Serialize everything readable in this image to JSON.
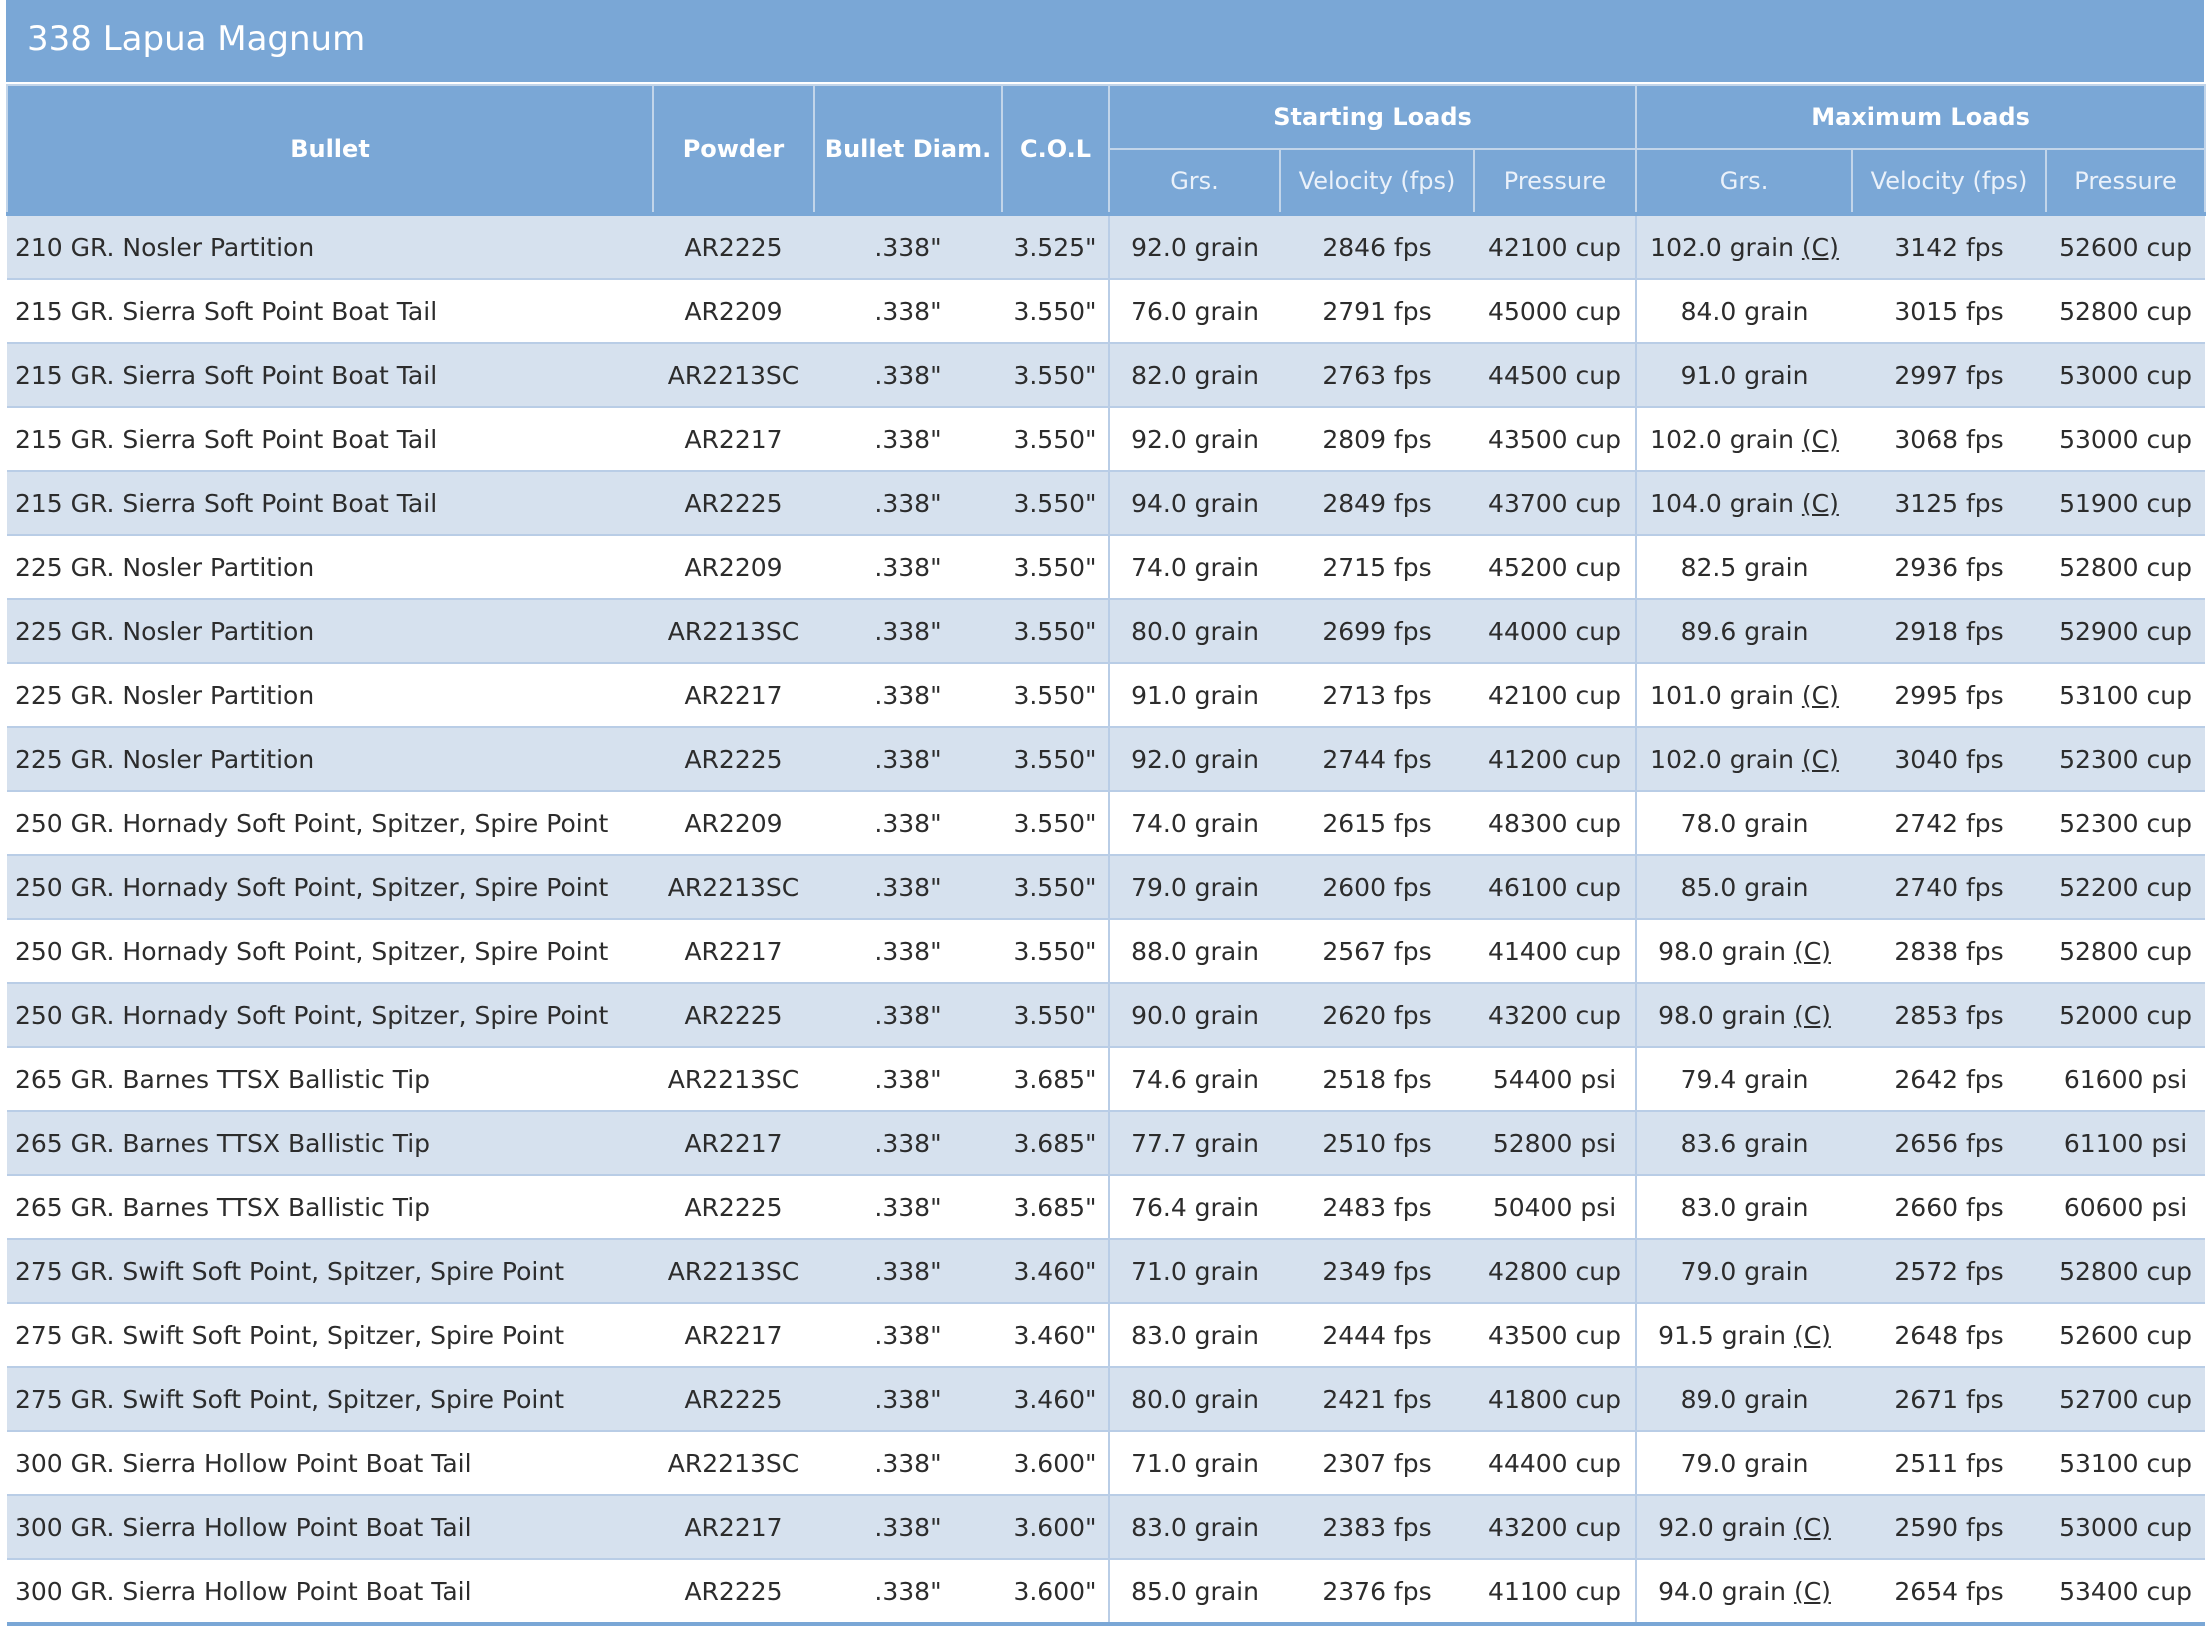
{
  "page": {
    "title": "338 Lapua Magnum"
  },
  "headers": {
    "bullet": "Bullet",
    "powder": "Powder",
    "bullet_diam": "Bullet Diam.",
    "col": "C.O.L",
    "starting_loads": "Starting Loads",
    "maximum_loads": "Maximum Loads",
    "grs": "Grs.",
    "velocity": "Velocity (fps)",
    "pressure": "Pressure"
  },
  "rows": [
    {
      "bullet": "210 GR. Nosler Partition",
      "powder": "AR2225",
      "diam": ".338\"",
      "col": "3.525\"",
      "s_grs": "92.0 grain",
      "s_vel": "2846 fps",
      "s_press": "42100 cup",
      "m_grs": "102.0 grain",
      "m_note": "(C)",
      "m_vel": "3142 fps",
      "m_press": "52600 cup"
    },
    {
      "bullet": "215 GR. Sierra Soft Point Boat Tail",
      "powder": "AR2209",
      "diam": ".338\"",
      "col": "3.550\"",
      "s_grs": "76.0 grain",
      "s_vel": "2791 fps",
      "s_press": "45000 cup",
      "m_grs": "84.0 grain",
      "m_note": "",
      "m_vel": "3015 fps",
      "m_press": "52800 cup"
    },
    {
      "bullet": "215 GR. Sierra Soft Point Boat Tail",
      "powder": "AR2213SC",
      "diam": ".338\"",
      "col": "3.550\"",
      "s_grs": "82.0 grain",
      "s_vel": "2763 fps",
      "s_press": "44500 cup",
      "m_grs": "91.0 grain",
      "m_note": "",
      "m_vel": "2997 fps",
      "m_press": "53000 cup"
    },
    {
      "bullet": "215 GR. Sierra Soft Point Boat Tail",
      "powder": "AR2217",
      "diam": ".338\"",
      "col": "3.550\"",
      "s_grs": "92.0 grain",
      "s_vel": "2809 fps",
      "s_press": "43500 cup",
      "m_grs": "102.0 grain",
      "m_note": "(C)",
      "m_vel": "3068 fps",
      "m_press": "53000 cup"
    },
    {
      "bullet": "215 GR. Sierra Soft Point Boat Tail",
      "powder": "AR2225",
      "diam": ".338\"",
      "col": "3.550\"",
      "s_grs": "94.0 grain",
      "s_vel": "2849 fps",
      "s_press": "43700 cup",
      "m_grs": "104.0 grain",
      "m_note": "(C)",
      "m_vel": "3125 fps",
      "m_press": "51900 cup"
    },
    {
      "bullet": "225 GR. Nosler Partition",
      "powder": "AR2209",
      "diam": ".338\"",
      "col": "3.550\"",
      "s_grs": "74.0 grain",
      "s_vel": "2715 fps",
      "s_press": "45200 cup",
      "m_grs": "82.5 grain",
      "m_note": "",
      "m_vel": "2936 fps",
      "m_press": "52800 cup"
    },
    {
      "bullet": "225 GR. Nosler Partition",
      "powder": "AR2213SC",
      "diam": ".338\"",
      "col": "3.550\"",
      "s_grs": "80.0 grain",
      "s_vel": "2699 fps",
      "s_press": "44000 cup",
      "m_grs": "89.6 grain",
      "m_note": "",
      "m_vel": "2918 fps",
      "m_press": "52900 cup"
    },
    {
      "bullet": "225 GR. Nosler Partition",
      "powder": "AR2217",
      "diam": ".338\"",
      "col": "3.550\"",
      "s_grs": "91.0 grain",
      "s_vel": "2713 fps",
      "s_press": "42100 cup",
      "m_grs": "101.0 grain",
      "m_note": "(C)",
      "m_vel": "2995 fps",
      "m_press": "53100 cup"
    },
    {
      "bullet": "225 GR. Nosler Partition",
      "powder": "AR2225",
      "diam": ".338\"",
      "col": "3.550\"",
      "s_grs": "92.0 grain",
      "s_vel": "2744 fps",
      "s_press": "41200 cup",
      "m_grs": "102.0 grain",
      "m_note": "(C)",
      "m_vel": "3040 fps",
      "m_press": "52300 cup"
    },
    {
      "bullet": "250 GR. Hornady Soft Point, Spitzer, Spire Point",
      "powder": "AR2209",
      "diam": ".338\"",
      "col": "3.550\"",
      "s_grs": "74.0 grain",
      "s_vel": "2615 fps",
      "s_press": "48300 cup",
      "m_grs": "78.0 grain",
      "m_note": "",
      "m_vel": "2742 fps",
      "m_press": "52300 cup"
    },
    {
      "bullet": "250 GR. Hornady Soft Point, Spitzer, Spire Point",
      "powder": "AR2213SC",
      "diam": ".338\"",
      "col": "3.550\"",
      "s_grs": "79.0 grain",
      "s_vel": "2600 fps",
      "s_press": "46100 cup",
      "m_grs": "85.0 grain",
      "m_note": "",
      "m_vel": "2740 fps",
      "m_press": "52200 cup"
    },
    {
      "bullet": "250 GR. Hornady Soft Point, Spitzer, Spire Point",
      "powder": "AR2217",
      "diam": ".338\"",
      "col": "3.550\"",
      "s_grs": "88.0 grain",
      "s_vel": "2567 fps",
      "s_press": "41400 cup",
      "m_grs": "98.0 grain",
      "m_note": "(C)",
      "m_vel": "2838 fps",
      "m_press": "52800 cup"
    },
    {
      "bullet": "250 GR. Hornady Soft Point, Spitzer, Spire Point",
      "powder": "AR2225",
      "diam": ".338\"",
      "col": "3.550\"",
      "s_grs": "90.0 grain",
      "s_vel": "2620 fps",
      "s_press": "43200 cup",
      "m_grs": "98.0 grain",
      "m_note": "(C)",
      "m_vel": "2853 fps",
      "m_press": "52000 cup"
    },
    {
      "bullet": "265 GR. Barnes TTSX Ballistic Tip",
      "powder": "AR2213SC",
      "diam": ".338\"",
      "col": "3.685\"",
      "s_grs": "74.6 grain",
      "s_vel": "2518 fps",
      "s_press": "54400 psi",
      "m_grs": "79.4 grain",
      "m_note": "",
      "m_vel": "2642 fps",
      "m_press": "61600 psi"
    },
    {
      "bullet": "265 GR. Barnes TTSX Ballistic Tip",
      "powder": "AR2217",
      "diam": ".338\"",
      "col": "3.685\"",
      "s_grs": "77.7 grain",
      "s_vel": "2510 fps",
      "s_press": "52800 psi",
      "m_grs": "83.6 grain",
      "m_note": "",
      "m_vel": "2656 fps",
      "m_press": "61100 psi"
    },
    {
      "bullet": "265 GR. Barnes TTSX Ballistic Tip",
      "powder": "AR2225",
      "diam": ".338\"",
      "col": "3.685\"",
      "s_grs": "76.4 grain",
      "s_vel": "2483 fps",
      "s_press": "50400 psi",
      "m_grs": "83.0 grain",
      "m_note": "",
      "m_vel": "2660 fps",
      "m_press": "60600 psi"
    },
    {
      "bullet": "275 GR. Swift Soft Point, Spitzer, Spire Point",
      "powder": "AR2213SC",
      "diam": ".338\"",
      "col": "3.460\"",
      "s_grs": "71.0 grain",
      "s_vel": "2349 fps",
      "s_press": "42800 cup",
      "m_grs": "79.0 grain",
      "m_note": "",
      "m_vel": "2572 fps",
      "m_press": "52800 cup"
    },
    {
      "bullet": "275 GR. Swift Soft Point, Spitzer, Spire Point",
      "powder": "AR2217",
      "diam": ".338\"",
      "col": "3.460\"",
      "s_grs": "83.0 grain",
      "s_vel": "2444 fps",
      "s_press": "43500 cup",
      "m_grs": "91.5 grain",
      "m_note": "(C)",
      "m_vel": "2648 fps",
      "m_press": "52600 cup"
    },
    {
      "bullet": "275 GR. Swift Soft Point, Spitzer, Spire Point",
      "powder": "AR2225",
      "diam": ".338\"",
      "col": "3.460\"",
      "s_grs": "80.0 grain",
      "s_vel": "2421 fps",
      "s_press": "41800 cup",
      "m_grs": "89.0 grain",
      "m_note": "",
      "m_vel": "2671 fps",
      "m_press": "52700 cup"
    },
    {
      "bullet": "300 GR. Sierra Hollow Point Boat Tail",
      "powder": "AR2213SC",
      "diam": ".338\"",
      "col": "3.600\"",
      "s_grs": "71.0 grain",
      "s_vel": "2307 fps",
      "s_press": "44400 cup",
      "m_grs": "79.0 grain",
      "m_note": "",
      "m_vel": "2511 fps",
      "m_press": "53100 cup"
    },
    {
      "bullet": "300 GR. Sierra Hollow Point Boat Tail",
      "powder": "AR2217",
      "diam": ".338\"",
      "col": "3.600\"",
      "s_grs": "83.0 grain",
      "s_vel": "2383 fps",
      "s_press": "43200 cup",
      "m_grs": "92.0 grain",
      "m_note": "(C)",
      "m_vel": "2590 fps",
      "m_press": "53000 cup"
    },
    {
      "bullet": "300 GR. Sierra Hollow Point Boat Tail",
      "powder": "AR2225",
      "diam": ".338\"",
      "col": "3.600\"",
      "s_grs": "85.0 grain",
      "s_vel": "2376 fps",
      "s_press": "41100 cup",
      "m_grs": "94.0 grain",
      "m_note": "(C)",
      "m_vel": "2654 fps",
      "m_press": "53400 cup"
    }
  ],
  "colors": {
    "header_bg": "#7aa7d6",
    "row_alt_bg": "#d6e1ee",
    "row_bg": "#ffffff",
    "text": "#2c2c2c"
  }
}
